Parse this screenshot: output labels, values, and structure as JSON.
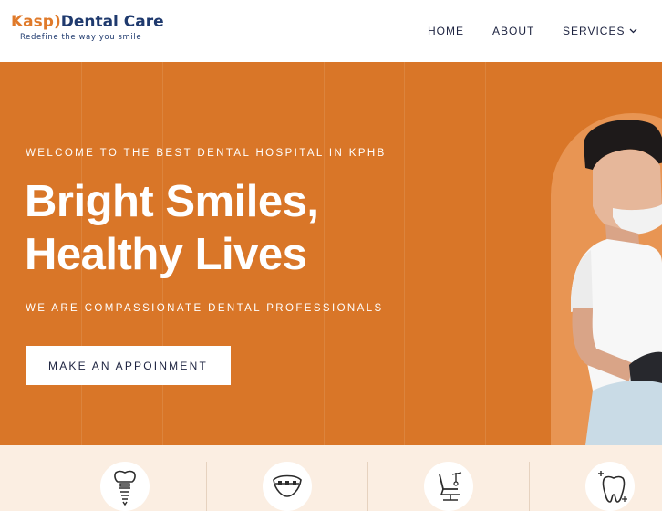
{
  "brand": {
    "name_part1": "Kasp",
    "name_part2": "Dental Care",
    "tagline": "Redefine the way you smile",
    "accent_color": "#e07a2a",
    "navy_color": "#1f3a6e"
  },
  "nav": {
    "items": [
      {
        "label": "HOME"
      },
      {
        "label": "ABOUT"
      },
      {
        "label": "SERVICES",
        "icon": "chevron-down-icon"
      }
    ]
  },
  "hero": {
    "eyebrow": "WELCOME TO THE BEST DENTAL HOSPITAL IN KPHB",
    "headline_line1": "Bright Smiles,",
    "headline_line2": "Healthy Lives",
    "subline": "WE ARE COMPASSIONATE DENTAL PROFESSIONALS",
    "cta_label": "MAKE AN APPOINMENT",
    "background_color": "#d97628"
  },
  "services": {
    "icons": [
      "dental-implant-icon",
      "braces-icon",
      "dental-chair-icon",
      "sparkling-tooth-icon"
    ]
  }
}
